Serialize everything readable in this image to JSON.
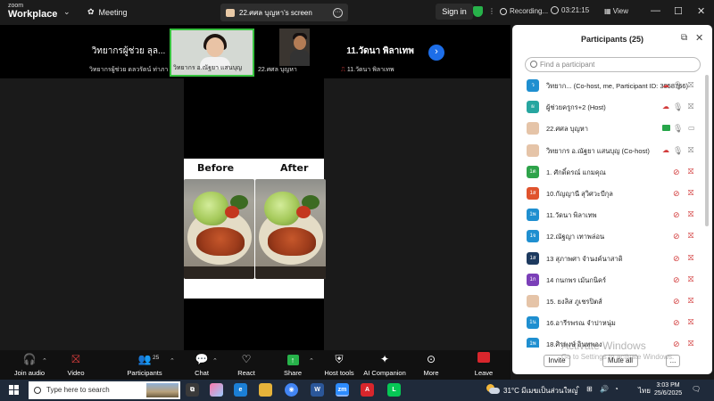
{
  "app": {
    "logo_line1": "zoom",
    "logo_line2": "Workplace",
    "meeting_label": "Meeting",
    "share_title": "22.ศศล บุญหา's screen",
    "sign_in": "Sign in",
    "recording": "Recording...",
    "timer": "03:21:15",
    "view": "View"
  },
  "thumbnails": [
    {
      "big": "วิทยากรผู้ช่วย ลุล...",
      "name": "วิทยากรผู้ช่วย ดลวรัตน์ ท่าภา"
    },
    {
      "name": "วิทยากร อ.ณัฐยา แสนบุญ",
      "active": true
    },
    {
      "name": "22.ศศล บุญหา"
    },
    {
      "big": "11.วัดนา พิลาเทพ",
      "name": "11.วัดนา พิลาเทพ"
    }
  ],
  "slide": {
    "before_label": "Before",
    "after_label": "After"
  },
  "panel": {
    "title": "Participants (25)",
    "search_placeholder": "Find a participant",
    "invite": "Invite",
    "mute_all": "Mute all",
    "more": "...",
    "participants": [
      {
        "avatar": "ว",
        "color": "#1f8fd0",
        "name": "วิทยาก... (Co-host, me, Participant ID: 3058766)",
        "icons": "cloud"
      },
      {
        "avatar": "ผ",
        "color": "#27a6a0",
        "name": "ผู้ช่วยครูกร+2 (Host)",
        "icons": "cloud"
      },
      {
        "avatar": "",
        "color": "photo",
        "name": "22.ศศล บุญหา",
        "icons": "green"
      },
      {
        "avatar": "",
        "color": "photo",
        "name": "วิทยากร อ.ณัฐยา แสนบุญ (Co-host)",
        "icons": "cloud"
      },
      {
        "avatar": "1ต",
        "color": "#2ea34a",
        "name": "1. ศักดิ์ดรณ์ แกมคุณ",
        "icons": "muted"
      },
      {
        "avatar": "1ส",
        "color": "#e0532d",
        "name": "10.กัญญานี สุวิศวะบีกุล",
        "icons": "muted"
      },
      {
        "avatar": "1พ",
        "color": "#1f8fd0",
        "name": "11.วัดนา พิลาเทพ",
        "icons": "muted"
      },
      {
        "avatar": "1จ",
        "color": "#1f8fd0",
        "name": "12.ณัฐญา เทาพล่อน",
        "icons": "muted"
      },
      {
        "avatar": "1ส",
        "color": "#1d3a5f",
        "name": "13 สุภาพศา จำนงค์นาสาดิ",
        "icons": "muted"
      },
      {
        "avatar": "1ก",
        "color": "#7b3fb8",
        "name": "14 กนกพร เม้นกนิคร์",
        "icons": "muted"
      },
      {
        "avatar": "",
        "color": "photo",
        "name": "15. ยงลิส ภูเชรปิตส์",
        "icons": "muted"
      },
      {
        "avatar": "1น",
        "color": "#1f8fd0",
        "name": "16.อารีรพรณ จำปาหนุ่ม",
        "icons": "muted"
      },
      {
        "avatar": "1พ",
        "color": "#1f8fd0",
        "name": "18.ศิรพงษ์ อินทพอง",
        "icons": "muted"
      }
    ]
  },
  "watermark": {
    "line1": "Activate Windows",
    "line2": "Go to Settings to activate Windows."
  },
  "toolbar": {
    "join_audio": "Join audio",
    "video": "Video",
    "participants": "Participants",
    "participants_count": "25",
    "chat": "Chat",
    "react": "React",
    "share": "Share",
    "host_tools": "Host tools",
    "ai_companion": "AI Companion",
    "more": "More",
    "leave": "Leave"
  },
  "taskbar": {
    "search_placeholder": "Type here to search",
    "weather": "31°C มีเมฆเป็นส่วนใหญ่",
    "language": "ไทย",
    "time": "3:03 PM",
    "date": "25/6/2025"
  },
  "colors": {
    "accent_blue": "#1d6ee8",
    "active_green": "#37c23f",
    "leave_red": "#d8262c",
    "muted_red": "#d23b3b"
  }
}
